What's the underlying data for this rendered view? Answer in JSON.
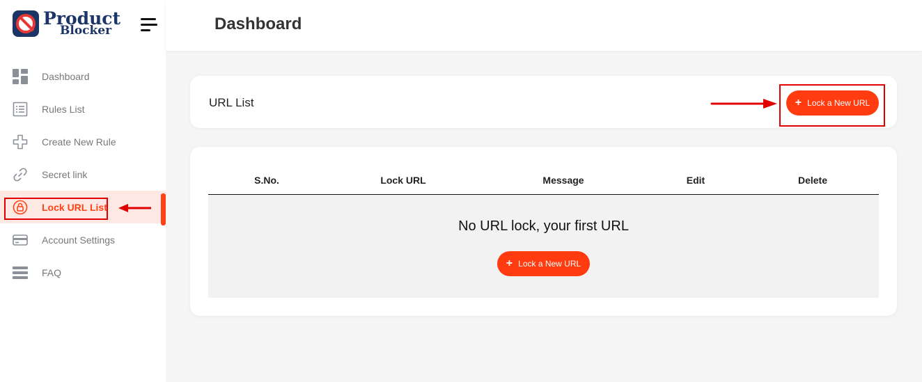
{
  "brand": {
    "line1": "Product",
    "line2": "Blocker"
  },
  "header": {
    "title": "Dashboard"
  },
  "sidebar": {
    "items": [
      {
        "label": "Dashboard",
        "icon": "dashboard-grid-icon"
      },
      {
        "label": "Rules List",
        "icon": "list-icon"
      },
      {
        "label": "Create New Rule",
        "icon": "plus-outline-icon"
      },
      {
        "label": "Secret link",
        "icon": "link-icon"
      },
      {
        "label": "Lock URL List",
        "icon": "lock-icon",
        "active": true
      },
      {
        "label": "Account Settings",
        "icon": "card-icon"
      },
      {
        "label": "FAQ",
        "icon": "bars-icon"
      }
    ]
  },
  "url_list": {
    "title": "URL List",
    "lock_button": "Lock a New URL"
  },
  "table": {
    "columns": [
      "S.No.",
      "Lock URL",
      "Message",
      "Edit",
      "Delete"
    ],
    "empty_message": "No URL lock, your first URL",
    "empty_button": "Lock a New URL"
  },
  "colors": {
    "accent": "#ff3b0f",
    "brand": "#1a3566",
    "annotation": "#e00000"
  }
}
